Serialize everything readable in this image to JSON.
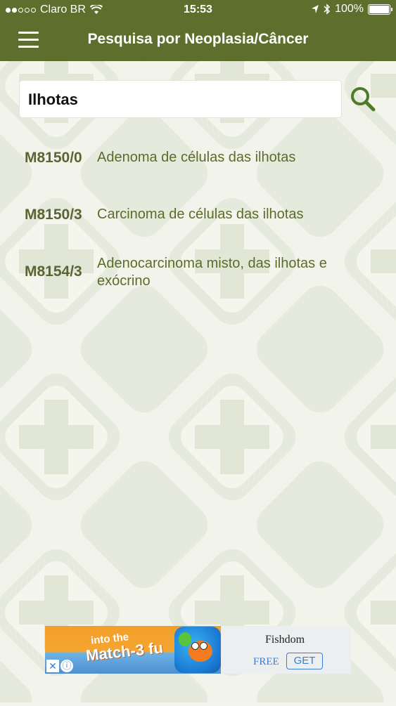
{
  "status_bar": {
    "carrier": "Claro BR",
    "time": "15:53",
    "battery": "100%",
    "battery_level": 1.0
  },
  "nav": {
    "title": "Pesquisa por Neoplasia/Câncer",
    "menu_icon": "hamburger-menu-icon"
  },
  "search": {
    "value": "Ilhotas",
    "icon": "search-icon"
  },
  "results": [
    {
      "code": "M8150/0",
      "description": "Adenoma de células das ilhotas"
    },
    {
      "code": "M8150/3",
      "description": "Carcinoma de células das ilhotas"
    },
    {
      "code": "M8154/3",
      "description": "Adenocarcinoma misto, das ilhotas e exócrino"
    }
  ],
  "ad": {
    "banner_line1": "into the",
    "banner_line2": "Match-3 fu",
    "app_name": "Fishdom",
    "price": "FREE",
    "cta": "GET",
    "close_symbol": "✕",
    "info_symbol": "ⓘ"
  },
  "colors": {
    "brand": "#5e6f2d",
    "code_text": "#5a6435",
    "desc_text": "#5c6b2a",
    "search_icon": "#4f7a2a"
  }
}
